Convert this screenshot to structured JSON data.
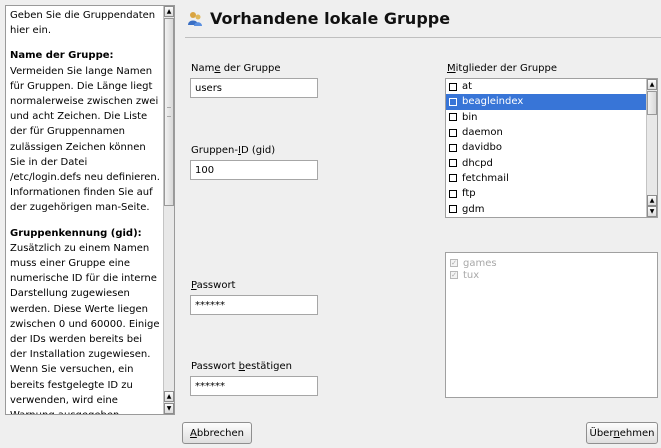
{
  "help": {
    "intro": "Geben Sie die Gruppendaten hier ein.",
    "section1_title": "Name der Gruppe:",
    "section1_text": "Vermeiden Sie lange Namen für Gruppen. Die Länge liegt normalerweise zwischen zwei und acht Zeichen. Die Liste der für Gruppennamen zulässigen Zeichen können Sie in der Datei /etc/login.defs neu definieren. Informationen finden Sie auf der zugehörigen man-Seite.",
    "section2_title": "Gruppenkennung (gid):",
    "section2_text": "Zusätzlich zu einem Namen muss einer Gruppe eine numerische ID für die interne Darstellung zugewiesen werden. Diese Werte liegen zwischen 0 und 60000. Einige der IDs werden bereits bei der Installation zugewiesen. Wenn Sie versuchen, ein bereits festgelegte ID zu verwenden, wird eine Warnung ausgegeben."
  },
  "dialog": {
    "title": "Vorhandene lokale Gruppe"
  },
  "form": {
    "group_name_label_pre": "Nam",
    "group_name_label_key": "e",
    "group_name_label_post": " der Gruppe",
    "group_name_value": "users",
    "gid_label_pre": "Gruppen-",
    "gid_label_key": "I",
    "gid_label_post": "D (gid)",
    "gid_value": "100",
    "password_label_key": "P",
    "password_label_post": "asswort",
    "password_value": "******",
    "confirm_label_pre": "Passwort ",
    "confirm_label_key": "b",
    "confirm_label_post": "estätigen",
    "confirm_value": "******"
  },
  "members": {
    "label_key": "M",
    "label_post": "itglieder der Gruppe",
    "items": [
      {
        "name": "at",
        "checked": false
      },
      {
        "name": "beagleindex",
        "checked": false,
        "selected": true
      },
      {
        "name": "bin",
        "checked": false
      },
      {
        "name": "daemon",
        "checked": false
      },
      {
        "name": "davidbo",
        "checked": false
      },
      {
        "name": "dhcpd",
        "checked": false
      },
      {
        "name": "fetchmail",
        "checked": false
      },
      {
        "name": "ftp",
        "checked": false
      },
      {
        "name": "gdm",
        "checked": false
      }
    ]
  },
  "secondary_members": {
    "items": [
      "games",
      "tux"
    ]
  },
  "buttons": {
    "cancel_key": "A",
    "cancel_post": "bbrechen",
    "apply_pre": "Über",
    "apply_key": "n",
    "apply_post": "ehmen"
  },
  "colors": {
    "selection": "#3875d7",
    "window_bg": "#efefef",
    "disabled_text": "#a8a8a8"
  },
  "icons": {
    "dialog_icon": "group-users-icon",
    "scroll_up": "arrow-up-icon",
    "scroll_down": "arrow-down-icon"
  }
}
